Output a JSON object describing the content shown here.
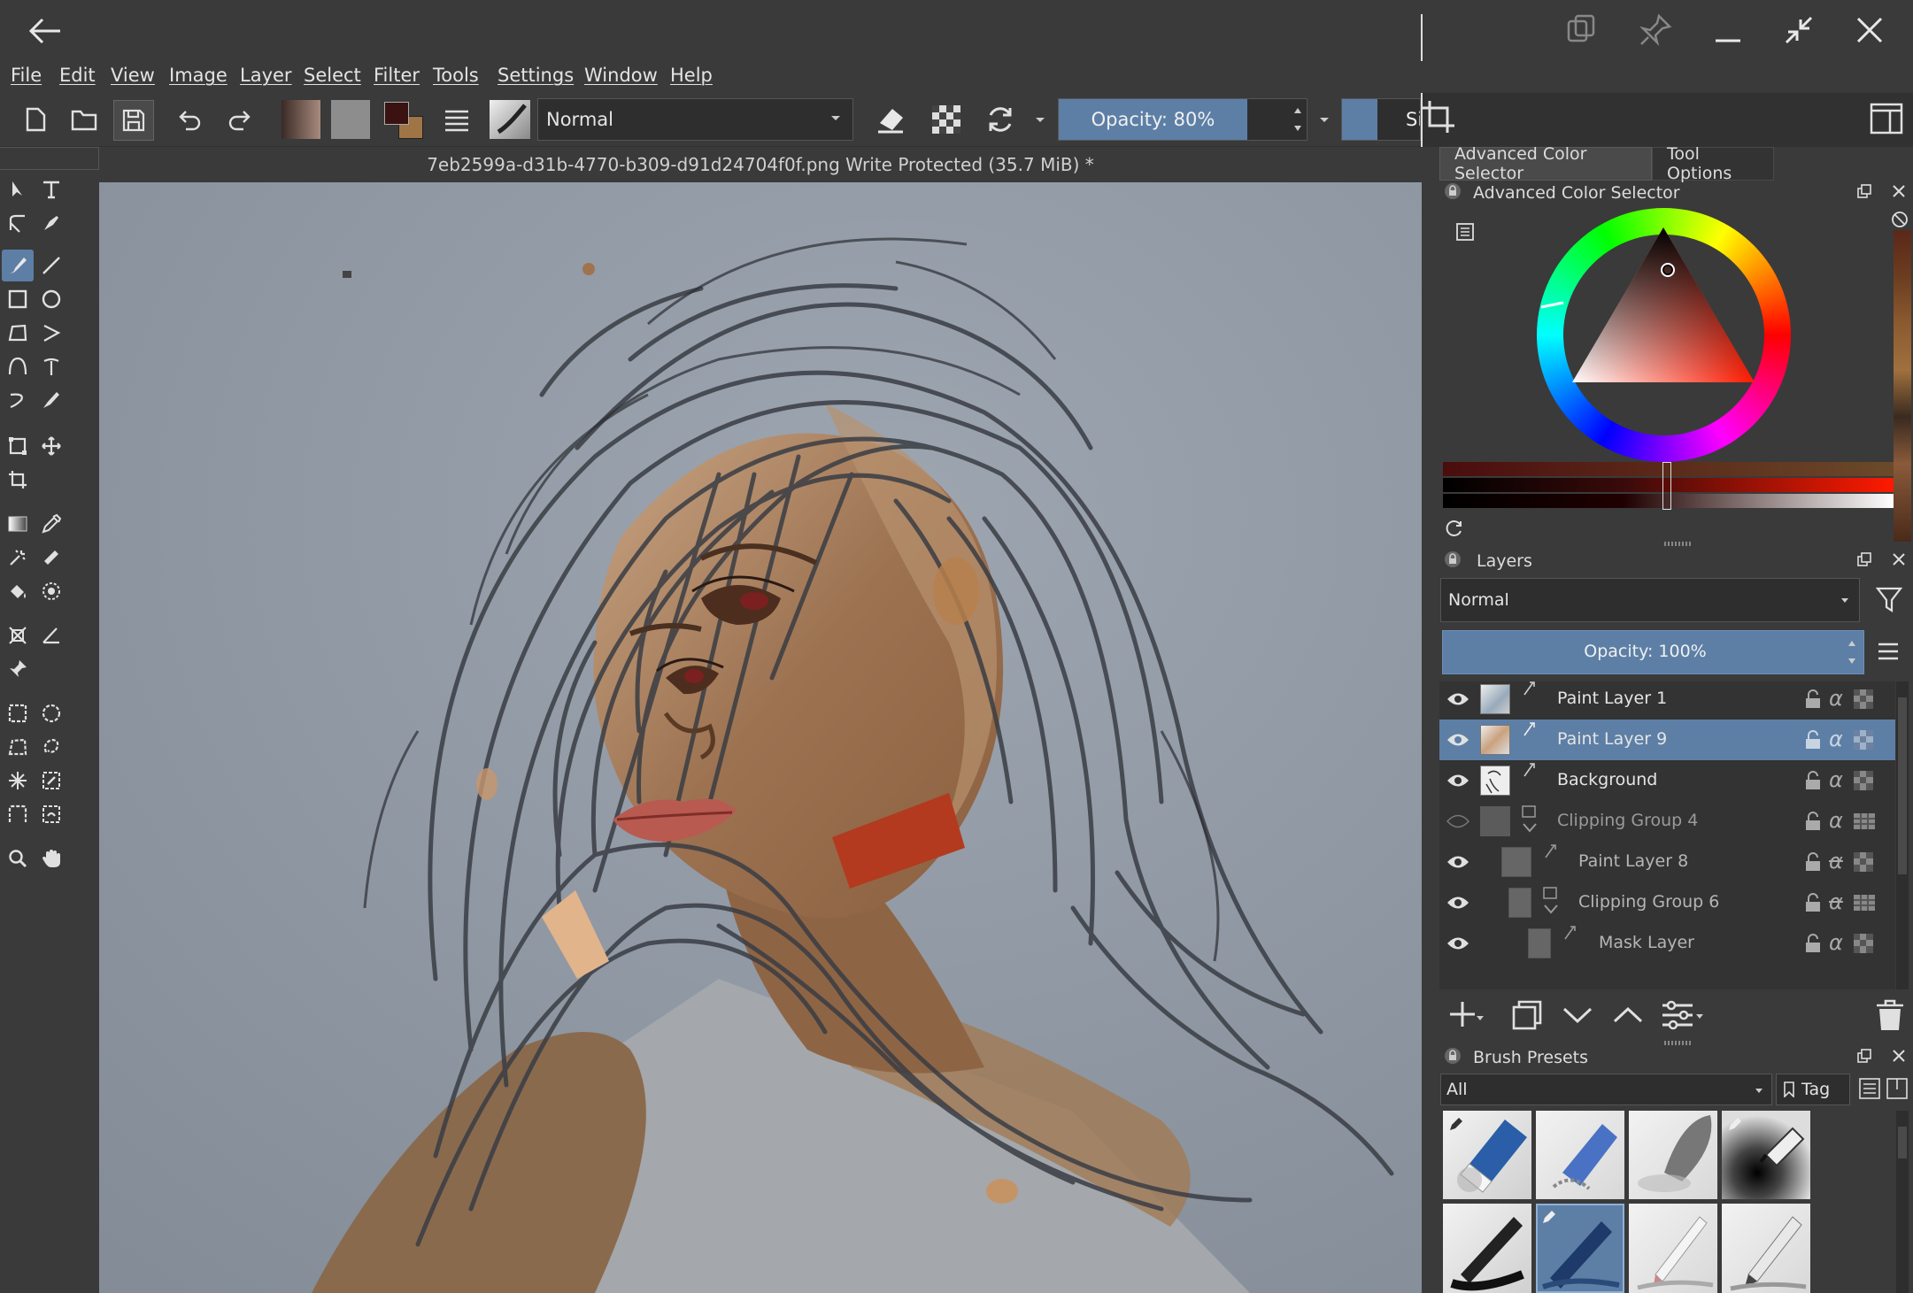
{
  "app": {
    "document_title": "7eb2599a-d31b-4770-b309-d91d24704f0f.png Write Protected  (35.7 MiB)  *"
  },
  "menu": [
    "File",
    "Edit",
    "View",
    "Image",
    "Layer",
    "Select",
    "Filter",
    "Tools",
    "Settings",
    "Window",
    "Help"
  ],
  "toolbar": {
    "blend_mode": "Normal",
    "opacity_label": "Opacity: 80%",
    "size_label_partial": "Si"
  },
  "tabs": {
    "advanced_color_selector": "Advanced Color Selector",
    "tool_options": "Tool Options"
  },
  "color_selector": {
    "title": "Advanced Color Selector"
  },
  "layers": {
    "title": "Layers",
    "blend_mode": "Normal",
    "opacity_label": "Opacity:  100%",
    "items": [
      {
        "name": "Paint Layer 1",
        "visible": true,
        "selected": false,
        "indent": 0
      },
      {
        "name": "Paint Layer 9",
        "visible": true,
        "selected": true,
        "indent": 0
      },
      {
        "name": "Background",
        "visible": true,
        "selected": false,
        "indent": 0
      },
      {
        "name": "Clipping Group 4",
        "visible": false,
        "selected": false,
        "indent": 0
      },
      {
        "name": "Paint Layer 8",
        "visible": true,
        "selected": false,
        "indent": 1
      },
      {
        "name": "Clipping Group 6",
        "visible": true,
        "selected": false,
        "indent": 1
      },
      {
        "name": "Mask Layer",
        "visible": true,
        "selected": false,
        "indent": 2
      }
    ]
  },
  "brush_presets": {
    "title": "Brush Presets",
    "filter_value": "All",
    "tag_label": "Tag"
  },
  "colors": {
    "panel_bg": "#3a3a3a",
    "selected_row": "#5d7fa6",
    "opacity_bar": "#5d7fa6",
    "canvas_bg": "#8f98a3"
  }
}
